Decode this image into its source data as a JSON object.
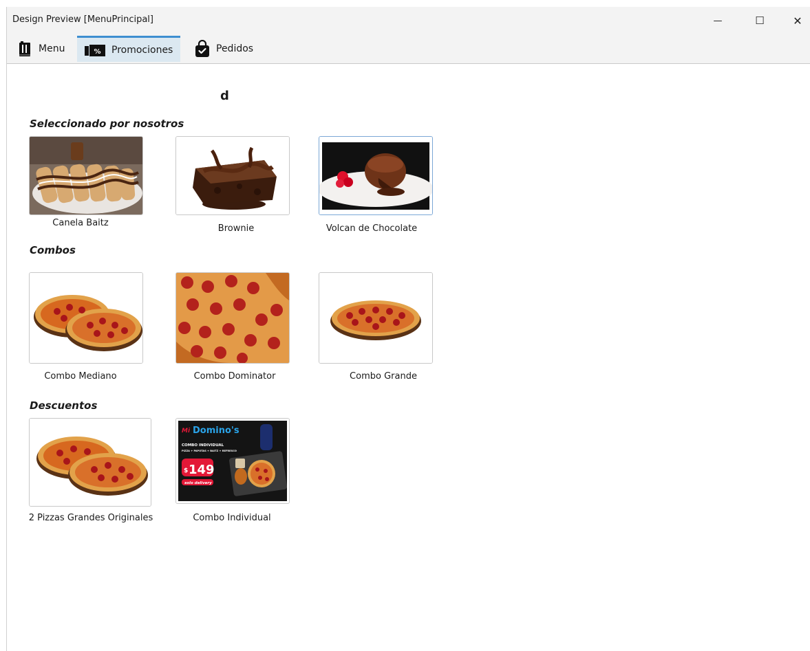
{
  "window": {
    "title": "Design Preview [MenuPrincipal]",
    "controls": {
      "minimize": "—",
      "maximize": "☐",
      "close": "✕"
    }
  },
  "tabs": [
    {
      "label": "Menu",
      "icon": "menu-book-icon",
      "active": false
    },
    {
      "label": "Promociones",
      "icon": "discount-tag-icon",
      "active": true
    },
    {
      "label": "Pedidos",
      "icon": "shopping-bag-icon",
      "active": false
    }
  ],
  "page": {
    "heading": "d",
    "sections": [
      {
        "title": "Seleccionado por nosotros",
        "items": [
          {
            "label": "Canela Baitz",
            "image": "cinnamon-bread-image"
          },
          {
            "label": "Brownie",
            "image": "brownie-image"
          },
          {
            "label": "Volcan de Chocolate",
            "image": "chocolate-lava-cake-image",
            "selected": true
          }
        ]
      },
      {
        "title": "Combos",
        "items": [
          {
            "label": "Combo Mediano",
            "image": "two-pizzas-image"
          },
          {
            "label": "Combo Dominator",
            "image": "pepperoni-pizza-closeup-image"
          },
          {
            "label": "Combo Grande",
            "image": "pepperoni-pizza-image"
          }
        ]
      },
      {
        "title": "Descuentos",
        "items": [
          {
            "label": "2 Pizzas Grandes Originales",
            "image": "two-pizzas-image"
          },
          {
            "label": "Combo Individual",
            "image": "dominos-promo-poster-image"
          }
        ]
      }
    ]
  },
  "promo_poster": {
    "brand": "Domino's",
    "headline": "COMBO INDIVIDUAL",
    "subline": "PIZZA + PAPOTAS + BAITZ + REFRESCO",
    "price_symbol": "$",
    "price": "149",
    "badge": "solo delivery"
  },
  "colors": {
    "accent": "#3e8ed0",
    "active_tab_bg": "#dbe8f1",
    "dominos_blue": "#0a6fb7",
    "dominos_red": "#e31837"
  }
}
